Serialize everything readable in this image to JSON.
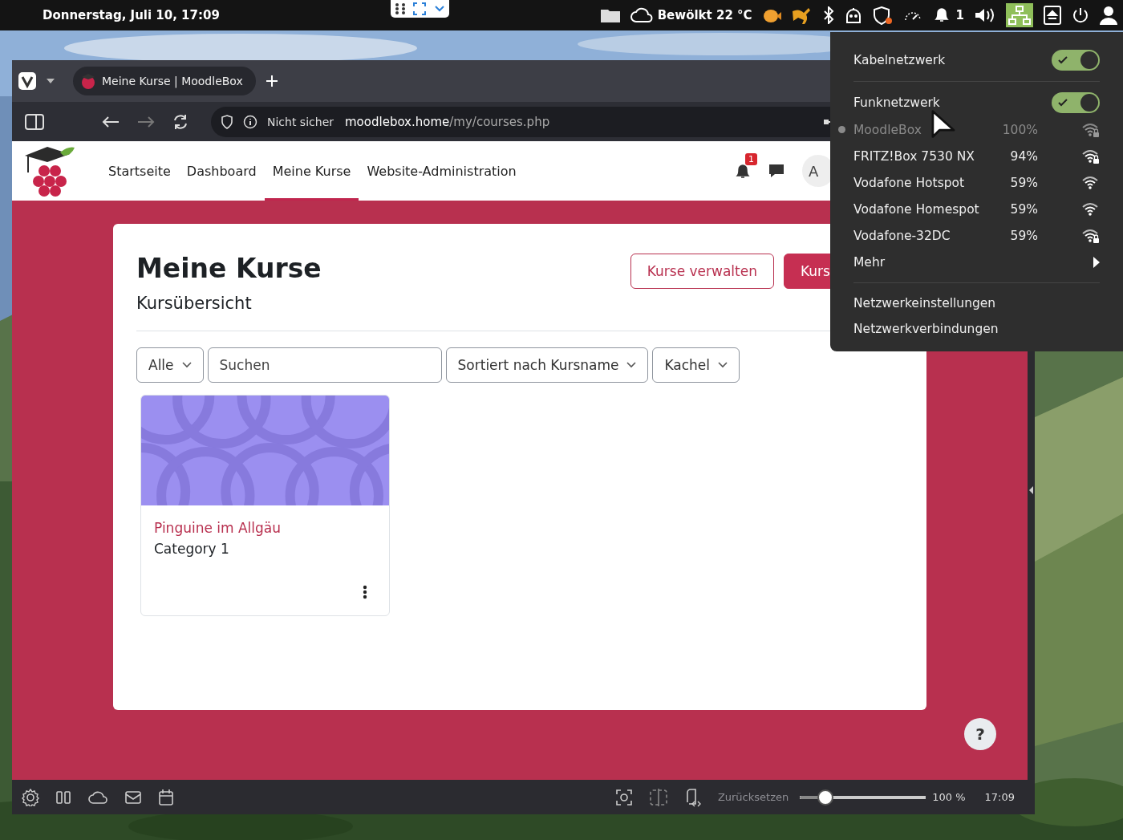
{
  "top_bar": {
    "clock": "Donnerstag, Juli 10, 17:09",
    "weather": "Bewölkt 22 °C",
    "notification_count": "1"
  },
  "browser": {
    "tab": {
      "title": "Meine Kurse | MoodleBox",
      "selected": true
    },
    "address": {
      "security": "Nicht sicher",
      "host": "moodlebox.home",
      "path": "/my/courses.php"
    },
    "nav": [
      {
        "label": "Startseite",
        "selected": false
      },
      {
        "label": "Dashboard",
        "selected": false
      },
      {
        "label": "Meine Kurse",
        "selected": true
      },
      {
        "label": "Website-Administration",
        "selected": false
      }
    ],
    "notification_badge": "1",
    "avatar": "A",
    "page": {
      "title": "Meine Kurse",
      "subtitle": "Kursübersicht",
      "buttons": [
        {
          "label": "Kurse verwalten",
          "kind": "outline"
        },
        {
          "label": "Kurs",
          "kind": "filled"
        }
      ],
      "filters": [
        {
          "kind": "dropdown",
          "value": "Alle"
        },
        {
          "kind": "search",
          "placeholder": "Suchen"
        },
        {
          "kind": "dropdown",
          "value": "Sortiert nach Kursname"
        },
        {
          "kind": "dropdown",
          "value": "Kachel"
        }
      ],
      "courses": [
        {
          "name": "Pinguine im Allgäu",
          "category": "Category 1"
        }
      ],
      "help": "?"
    },
    "status_bar": {
      "reset": "Zurücksetzen",
      "zoom": {
        "level": 0.2,
        "reading": "100 %"
      },
      "time": "17:09"
    }
  },
  "network_menu": {
    "items": [
      {
        "kind": "toggle",
        "label": "Kabelnetzwerk",
        "on": true
      },
      {
        "kind": "separator"
      },
      {
        "kind": "toggle",
        "label": "Funknetzwerk",
        "on": true
      },
      {
        "kind": "network",
        "name": "MoodleBox",
        "signal": "100%",
        "connected": true,
        "secured": true
      },
      {
        "kind": "network",
        "name": "FRITZ!Box 7530 NX",
        "signal": "94%",
        "connected": false,
        "secured": true
      },
      {
        "kind": "network",
        "name": "Vodafone Hotspot",
        "signal": "59%",
        "connected": false,
        "secured": false
      },
      {
        "kind": "network",
        "name": "Vodafone Homespot",
        "signal": "59%",
        "connected": false,
        "secured": false
      },
      {
        "kind": "network",
        "name": "Vodafone-32DC",
        "signal": "59%",
        "connected": false,
        "secured": true
      },
      {
        "kind": "submenu",
        "label": "Mehr"
      },
      {
        "kind": "separator"
      },
      {
        "kind": "link",
        "label": "Netzwerkeinstellungen"
      },
      {
        "kind": "link",
        "label": "Netzwerkverbindungen"
      }
    ]
  }
}
